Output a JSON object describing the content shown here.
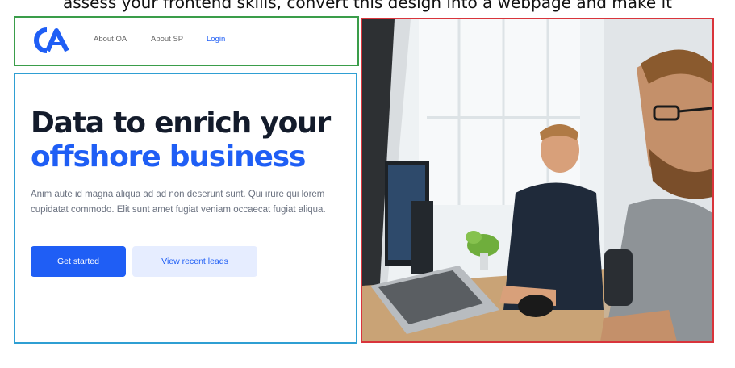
{
  "caption": "assess your frontend skills, convert this design into a webpage and make it",
  "nav": {
    "logo_text": "OA",
    "links": [
      {
        "label": "About OA"
      },
      {
        "label": "About SP"
      },
      {
        "label": "Login"
      }
    ]
  },
  "hero": {
    "headline_line1": "Data to enrich your",
    "headline_line2": "offshore business",
    "paragraph": "Anim aute id magna aliqua ad ad non deserunt sunt. Qui irure qui lorem cupidatat commodo. Elit sunt amet fugiat veniam occaecat fugiat aliqua.",
    "primary_button": "Get started",
    "secondary_button": "View recent leads"
  },
  "colors": {
    "brand_blue": "#1f5ef5",
    "heading_dark": "#131b2b",
    "nav_border": "#3a9d4a",
    "hero_border": "#2f9fd3",
    "image_border": "#d9343b"
  },
  "image": {
    "description_icon": "photo-icon"
  }
}
